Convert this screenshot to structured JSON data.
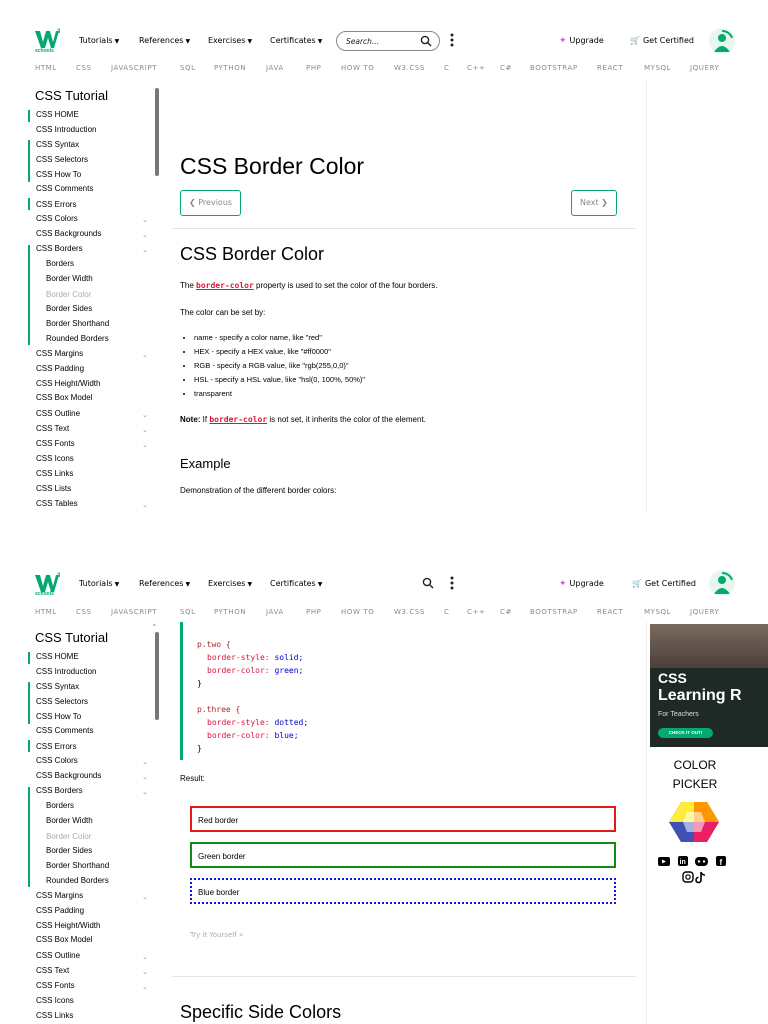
{
  "logo": {
    "word": "schools",
    "mark": "W3"
  },
  "header": {
    "menus": [
      "Tutorials",
      "References",
      "Exercises",
      "Certificates"
    ],
    "search_placeholder": "Search...",
    "upgrade": "Upgrade",
    "get_certified": "Get Certified"
  },
  "subnav": [
    "HTML",
    "CSS",
    "JAVASCRIPT",
    "SQL",
    "PYTHON",
    "JAVA",
    "PHP",
    "HOW TO",
    "W3.CSS",
    "C",
    "C++",
    "C#",
    "BOOTSTRAP",
    "REACT",
    "MYSQL",
    "JQUERY"
  ],
  "sidebar": {
    "title": "CSS Tutorial",
    "items": [
      "CSS HOME",
      "CSS Introduction",
      "CSS Syntax",
      "CSS Selectors",
      "CSS How To",
      "CSS Comments",
      "CSS Errors",
      "CSS Colors",
      "CSS Backgrounds",
      "CSS Borders",
      "Borders",
      "Border Width",
      "Border Color",
      "Border Sides",
      "Border Shorthand",
      "Rounded Borders",
      "CSS Margins",
      "CSS Padding",
      "CSS Height/Width",
      "CSS Box Model",
      "CSS Outline",
      "CSS Text",
      "CSS Fonts",
      "CSS Icons",
      "CSS Links",
      "CSS Lists",
      "CSS Tables"
    ]
  },
  "page": {
    "h1": "CSS Border Color",
    "previous": "❮ Previous",
    "next": "Next ❯",
    "h2": "CSS Border Color",
    "intro_pre": "The ",
    "intro_code": "border-color",
    "intro_post": " property is used to set the color of the four borders.",
    "can_be_set": "The color can be set by:",
    "list": [
      "name - specify a color name, like \"red\"",
      "HEX - specify a HEX value, like \"#ff0000\"",
      "RGB - specify a RGB value, like \"rgb(255,0,0)\"",
      "HSL - specify a HSL value, like \"hsl(0, 100%, 50%)\"",
      "transparent"
    ],
    "note_label": "Note:",
    "note_pre": " If ",
    "note_code": "border-color",
    "note_post": " is not set, it inherits the color of the element.",
    "example_h": "Example",
    "example_p": "Demonstration of the different border colors:"
  },
  "code": {
    "lines": [
      "}",
      "",
      "p.two {",
      "border-style: solid;",
      "border-color: green;",
      "}",
      "",
      "p.three {",
      "border-style: dotted;",
      "border-color: blue;",
      "}"
    ],
    "two_sel": "p.two {",
    "two_style_prop": "border-style:",
    "two_style_val": "solid;",
    "two_color_prop": "border-color:",
    "two_color_val": "green;",
    "close": "}",
    "three_sel": "p.three {",
    "three_style_prop": "border-style:",
    "three_style_val": "dotted;",
    "three_color_prop": "border-color:",
    "three_color_val": "blue;"
  },
  "result": {
    "label": "Result:",
    "red": "Red border",
    "green": "Green border",
    "blue": "Blue border",
    "try": "Try it Yourself »",
    "next_h": "Specific Side Colors"
  },
  "ad": {
    "title1": "CSS",
    "title2": "Learning R",
    "sub": "For Teachers",
    "btn": "CHECK IT OUT!"
  },
  "color_picker": [
    "COLOR",
    "PICKER"
  ],
  "colors": {
    "accent": "#04aa6d",
    "code_red": "#dc143c",
    "code_blue": "#0000cd"
  }
}
